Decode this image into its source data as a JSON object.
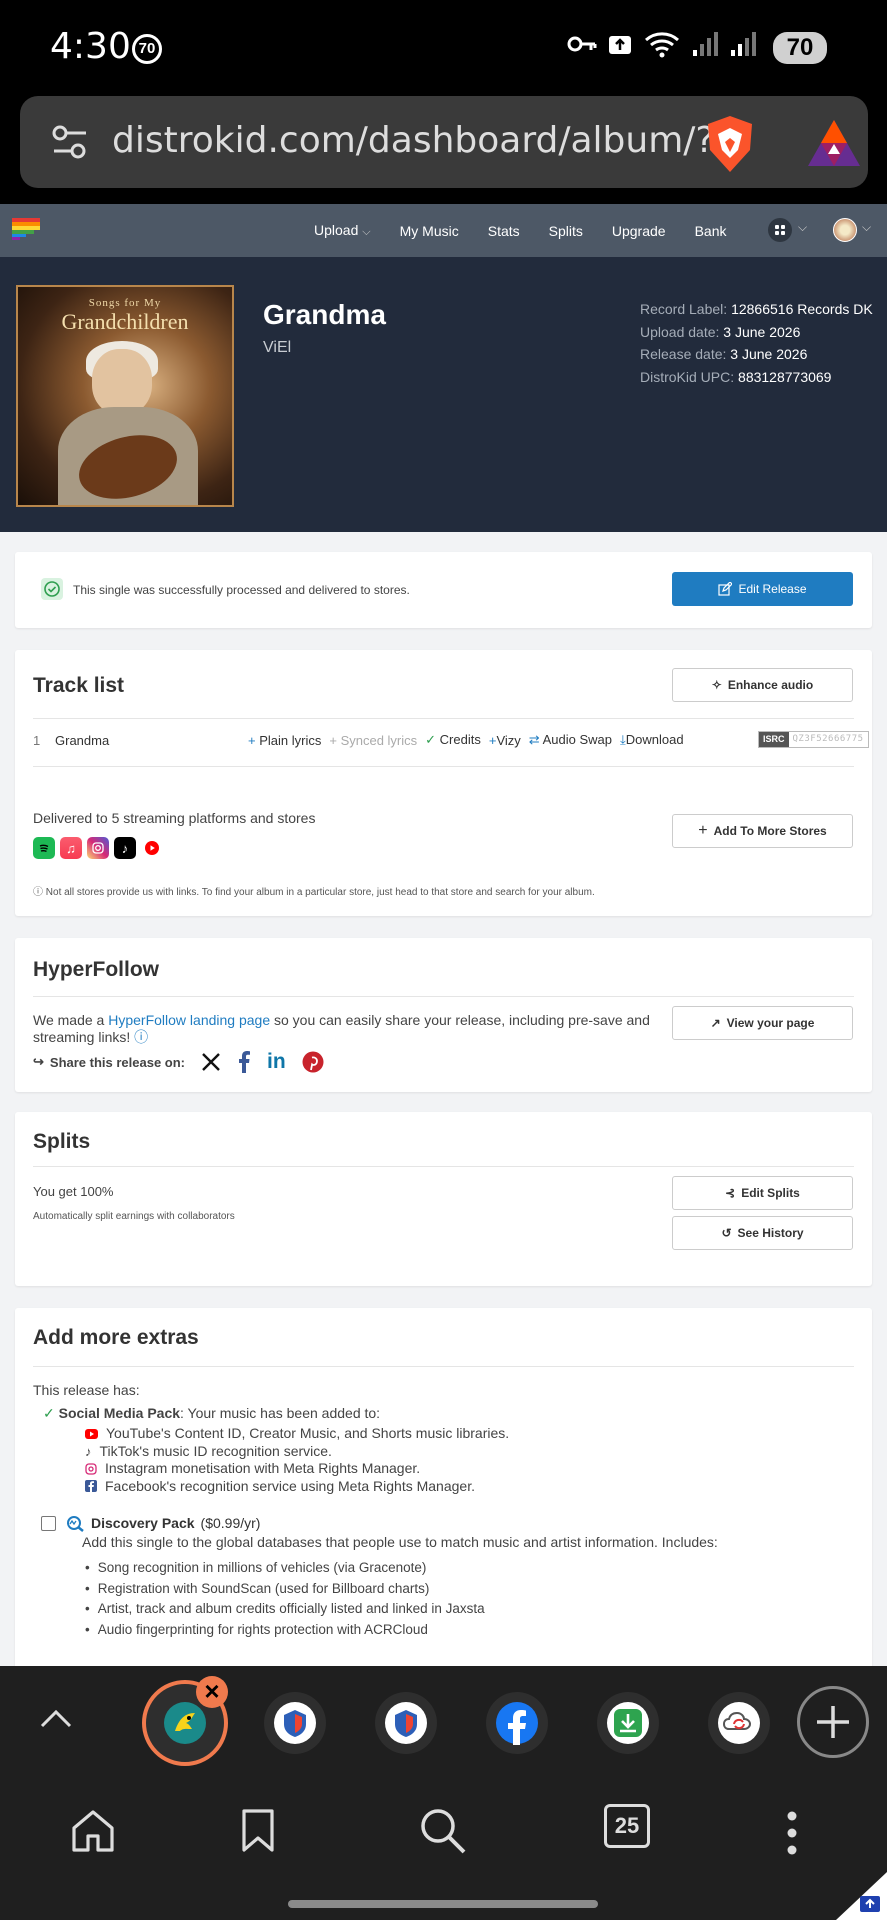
{
  "status": {
    "time": "4:30",
    "notif_count": "70",
    "battery": "70"
  },
  "browser": {
    "url": "distrokid.com/dashboard/album/?"
  },
  "nav": {
    "items": [
      {
        "label": "Upload"
      },
      {
        "label": "My Music"
      },
      {
        "label": "Stats"
      },
      {
        "label": "Splits"
      },
      {
        "label": "Upgrade"
      },
      {
        "label": "Bank"
      }
    ]
  },
  "album": {
    "cover_subtitle": "Songs for My",
    "cover_title": "Grandchildren",
    "title": "Grandma",
    "artist": "ViEl",
    "record_label_key": "Record Label:",
    "record_label": "12866516 Records DK",
    "upload_date_key": "Upload date:",
    "upload_date": "3 June 2026",
    "release_date_key": "Release date:",
    "release_date": "3 June 2026",
    "upc_key": "DistroKid UPC:",
    "upc": "883128773069"
  },
  "delivered": {
    "message": "This single was successfully processed and delivered to stores.",
    "edit_release": "Edit Release"
  },
  "tracklist": {
    "heading": "Track list",
    "enhance": "Enhance audio",
    "track_number": "1",
    "track_name": "Grandma",
    "plain_lyrics": "Plain lyrics",
    "synced_lyrics": "Synced lyrics",
    "credits": "Credits",
    "vizy": "Vizy",
    "audio_swap": "Audio Swap",
    "download": "Download",
    "isrc_tag": "ISRC",
    "isrc_value": "QZ3F52666775",
    "delivered_to": "Delivered to 5 streaming platforms and stores",
    "add_stores": "Add To More Stores",
    "note": "Not all stores provide us with links. To find your album in a particular store, just head to that store and search for your album.",
    "platforms": [
      "spotify-icon",
      "apple-music-icon",
      "instagram-icon",
      "tiktok-icon",
      "youtube-icon"
    ]
  },
  "hyperfollow": {
    "heading": "HyperFollow",
    "text_before": "We made a ",
    "link": "HyperFollow landing page",
    "text_after": " so you can easily share your release, including pre-save and streaming links!",
    "view_page": "View your page",
    "share_label": "Share this release on:"
  },
  "splits": {
    "heading": "Splits",
    "you_get": "You get 100%",
    "auto": "Automatically split earnings with collaborators",
    "edit": "Edit Splits",
    "history": "See History"
  },
  "extras": {
    "heading": "Add more extras",
    "has": "This release has:",
    "smp_title": "Social Media Pack",
    "smp_text": ": Your music has been added to:",
    "smp_items": [
      "YouTube's Content ID, Creator Music, and Shorts music libraries.",
      "TikTok's music ID recognition service.",
      "Instagram monetisation with Meta Rights Manager.",
      "Facebook's recognition service using Meta Rights Manager."
    ],
    "discovery_title": "Discovery Pack",
    "discovery_price": "($0.99/yr)",
    "discovery_desc": "Add this single to the global databases that people use to match music and artist information. Includes:",
    "discovery_items": [
      "Song recognition in millions of vehicles (via Gracenote)",
      "Registration with SoundScan (used for Billboard charts)",
      "Artist, track and album credits officially listed and linked in Jaxsta",
      "Audio fingerprinting for rights protection with ACRCloud"
    ]
  },
  "toolbar": {
    "tab_count": "25"
  },
  "colors": {
    "accent": "#1f7cc1",
    "hero_bg": "#222b3c",
    "nav_bg": "#4d5866",
    "tab_active": "#f07a4d"
  }
}
